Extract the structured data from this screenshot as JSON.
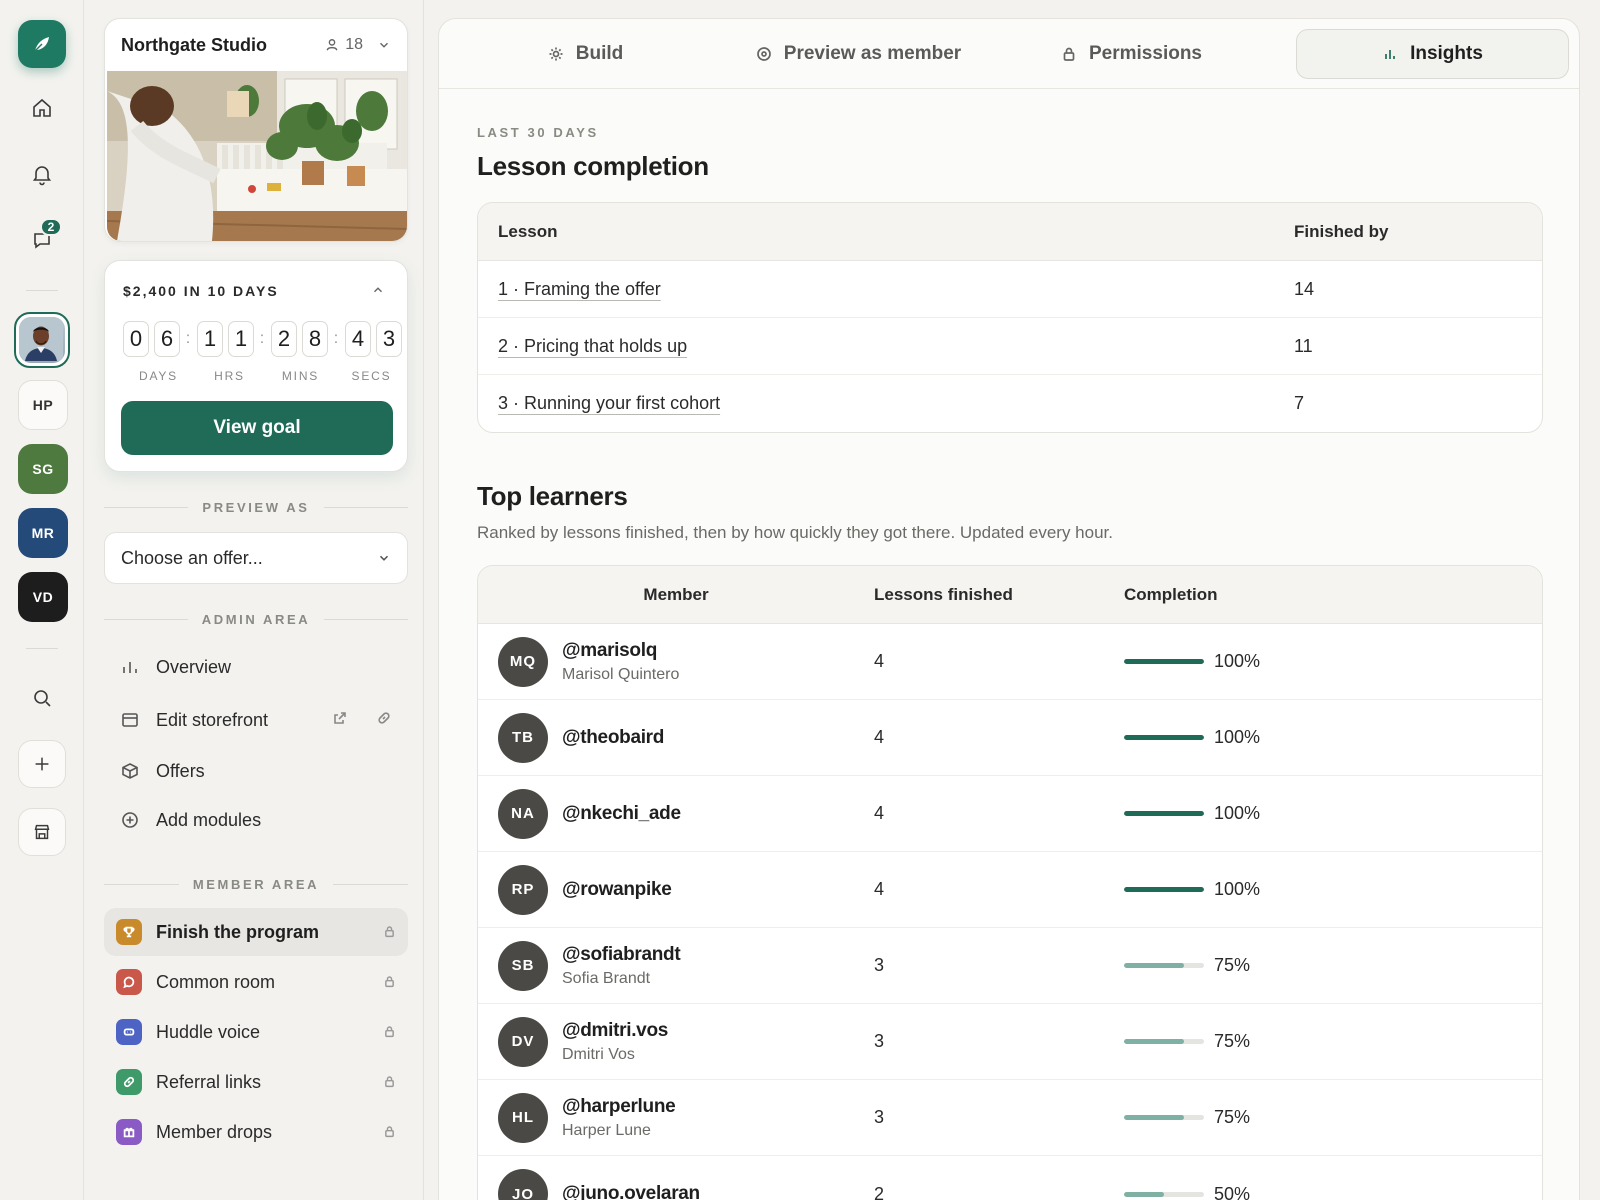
{
  "rail": {
    "chat_badge": "2",
    "workspaces": [
      "HP",
      "SG",
      "MR",
      "VD"
    ]
  },
  "studio": {
    "name": "Northgate Studio",
    "member_count": "18"
  },
  "goal": {
    "title": "$2,400 IN 10 DAYS",
    "digits": [
      "0",
      "6",
      "1",
      "1",
      "2",
      "8",
      "4",
      "3"
    ],
    "labels": [
      "DAYS",
      "HRS",
      "MINS",
      "SECS"
    ],
    "button": "View goal"
  },
  "preview": {
    "section": "PREVIEW AS",
    "placeholder": "Choose an offer..."
  },
  "admin": {
    "section": "ADMIN AREA",
    "items": [
      "Overview",
      "Edit storefront",
      "Offers",
      "Add modules"
    ]
  },
  "member_area": {
    "section": "MEMBER AREA",
    "items": [
      {
        "label": "Finish the program",
        "color": "#c98a2b"
      },
      {
        "label": "Common room",
        "color": "#c9584a"
      },
      {
        "label": "Huddle voice",
        "color": "#4d64c4"
      },
      {
        "label": "Referral links",
        "color": "#3f9a6a"
      },
      {
        "label": "Member drops",
        "color": "#8a5bc4"
      }
    ]
  },
  "tabs": [
    "Build",
    "Preview as member",
    "Permissions",
    "Insights"
  ],
  "insights": {
    "eyebrow": "LAST 30 DAYS",
    "completion_title": "Lesson completion",
    "completion_headers": [
      "Lesson",
      "Finished by"
    ],
    "lessons": [
      {
        "name": "1 · Framing the offer",
        "finished": "14"
      },
      {
        "name": "2 · Pricing that holds up",
        "finished": "11"
      },
      {
        "name": "3 · Running your first cohort",
        "finished": "7"
      }
    ],
    "learners_title": "Top learners",
    "learners_subtitle": "Ranked by lessons finished, then by how quickly they got there. Updated every hour.",
    "learner_headers": [
      "Member",
      "Lessons finished",
      "Completion"
    ],
    "learners": [
      {
        "initials": "MQ",
        "handle": "@marisolq",
        "name": "Marisol Quintero",
        "lessons": "4",
        "completion": 100,
        "pct": "100%"
      },
      {
        "initials": "TB",
        "handle": "@theobaird",
        "name": "",
        "lessons": "4",
        "completion": 100,
        "pct": "100%"
      },
      {
        "initials": "NA",
        "handle": "@nkechi_ade",
        "name": "",
        "lessons": "4",
        "completion": 100,
        "pct": "100%"
      },
      {
        "initials": "RP",
        "handle": "@rowanpike",
        "name": "",
        "lessons": "4",
        "completion": 100,
        "pct": "100%"
      },
      {
        "initials": "SB",
        "handle": "@sofiabrandt",
        "name": "Sofia Brandt",
        "lessons": "3",
        "completion": 75,
        "pct": "75%"
      },
      {
        "initials": "DV",
        "handle": "@dmitri.vos",
        "name": "Dmitri Vos",
        "lessons": "3",
        "completion": 75,
        "pct": "75%"
      },
      {
        "initials": "HL",
        "handle": "@harperlune",
        "name": "Harper Lune",
        "lessons": "3",
        "completion": 75,
        "pct": "75%"
      },
      {
        "initials": "JO",
        "handle": "@juno.ovelaran",
        "name": "",
        "lessons": "2",
        "completion": 50,
        "pct": "50%"
      }
    ]
  },
  "colors": {
    "accent": "#1f6b57",
    "bar_full": "#1f6b57",
    "bar_partial": "#7fb0a3"
  }
}
